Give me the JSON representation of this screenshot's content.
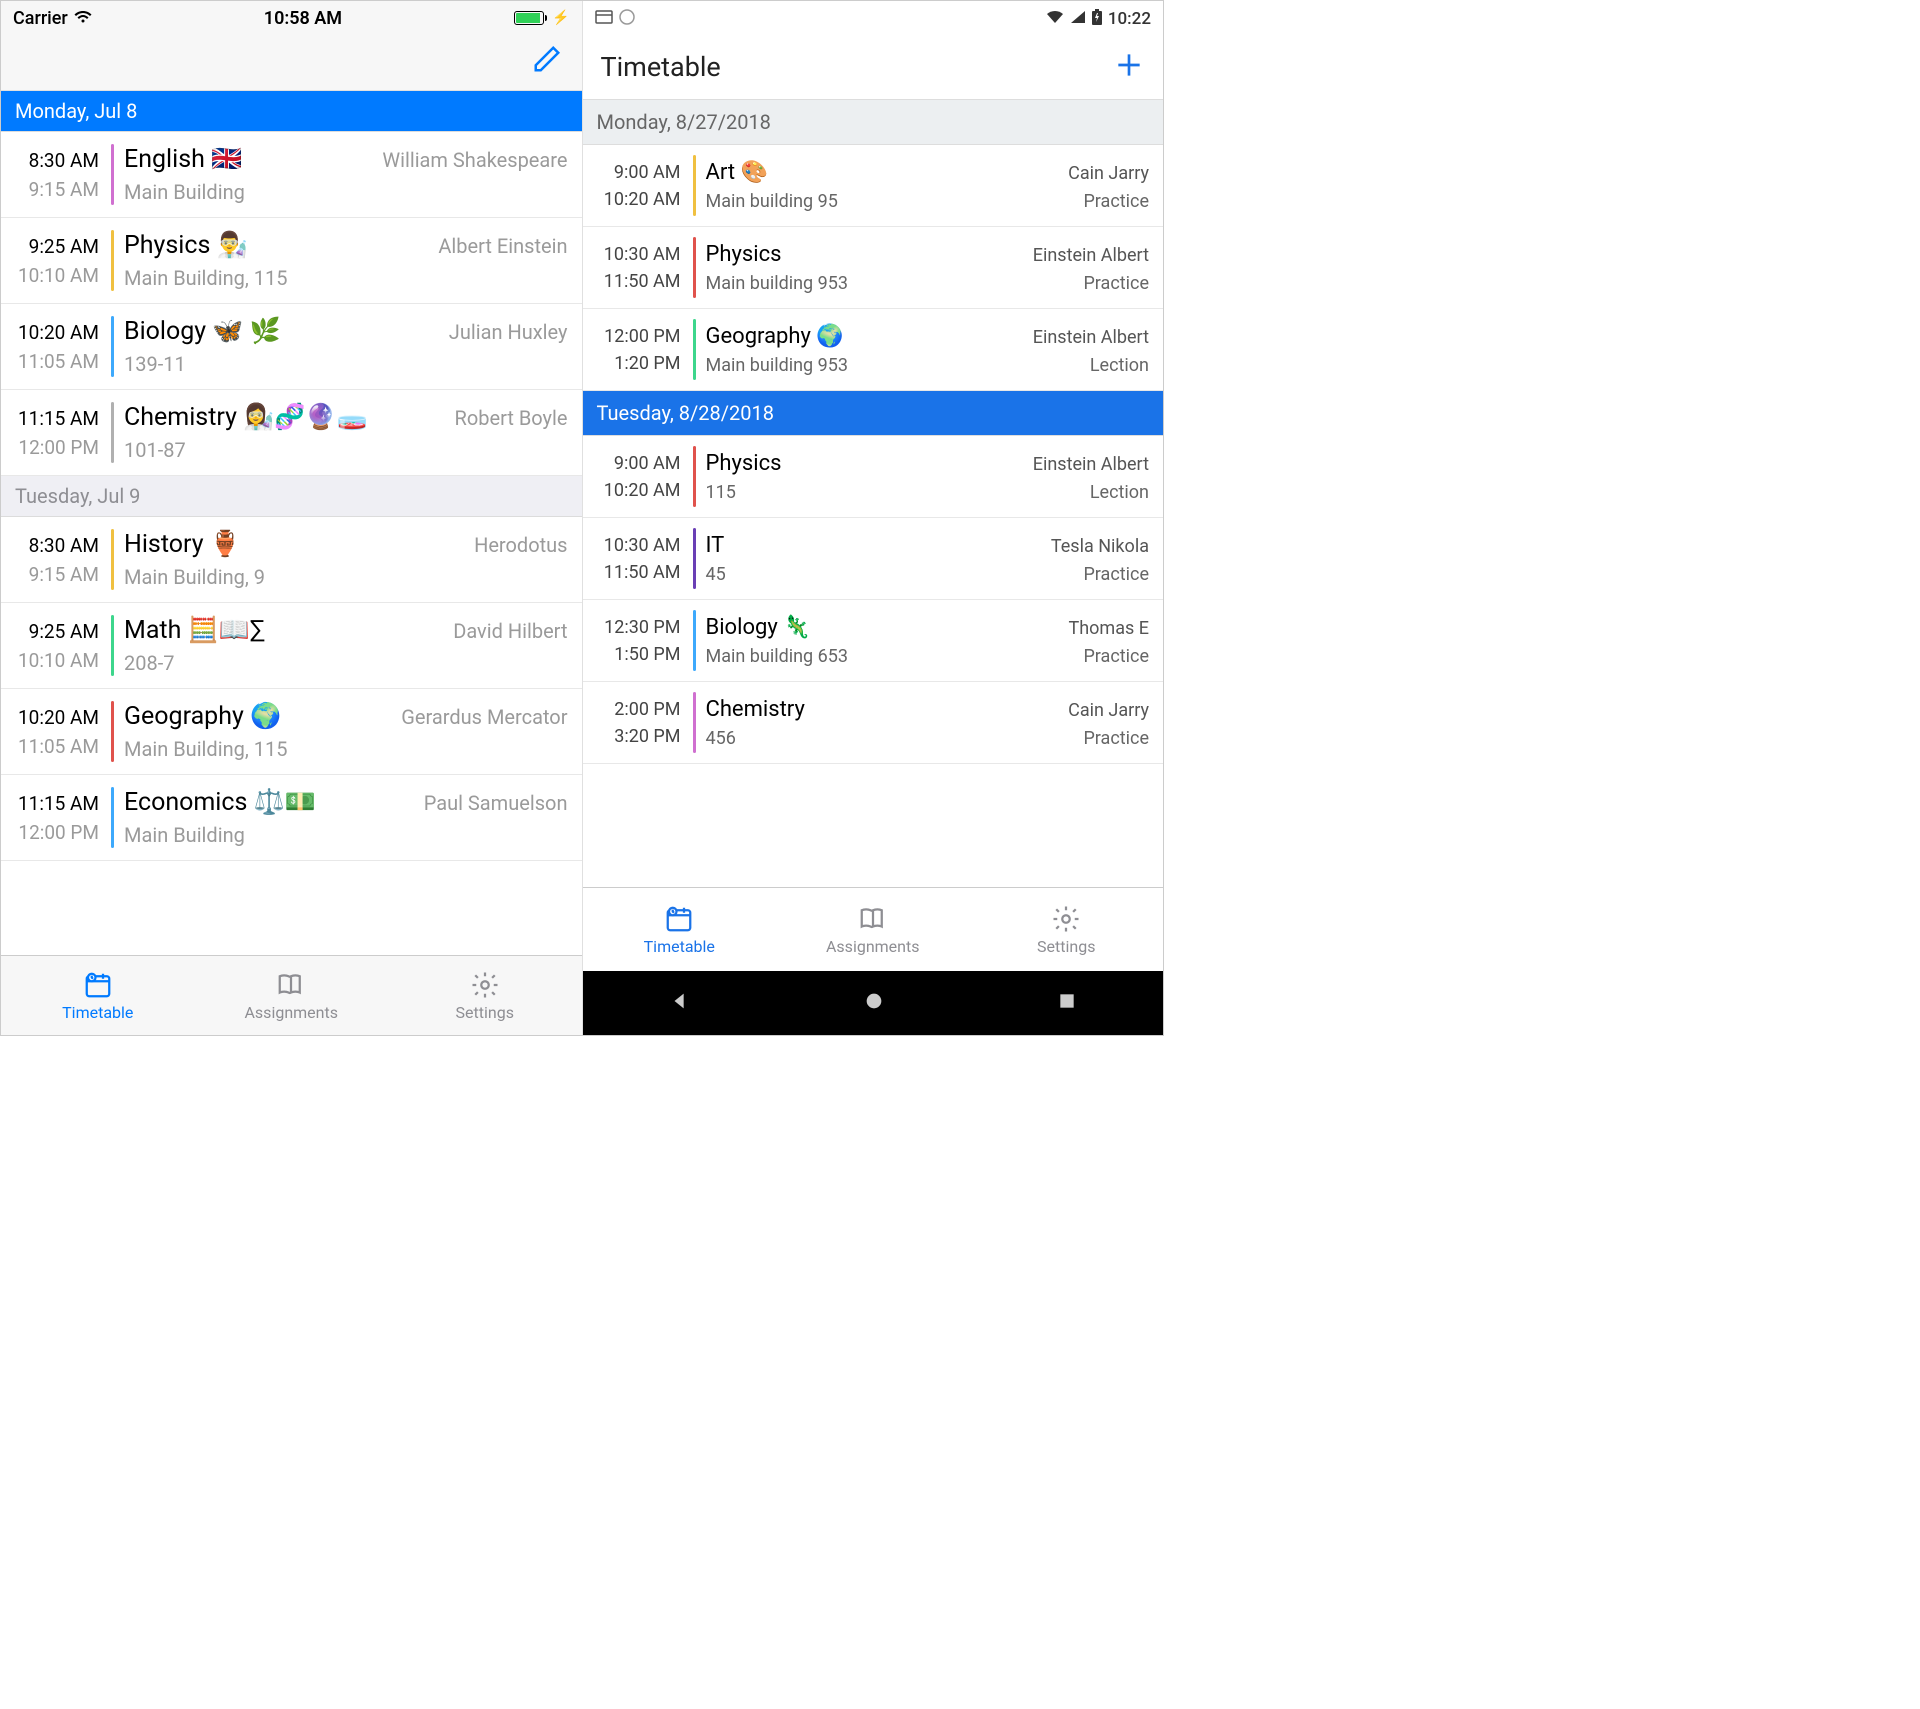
{
  "ios": {
    "status": {
      "carrier": "Carrier",
      "time": "10:58 AM"
    },
    "sections": [
      {
        "header": "Monday, Jul 8",
        "active": true,
        "rows": [
          {
            "start": "8:30 AM",
            "end": "9:15 AM",
            "subject": "English 🇬🇧",
            "teacher": "William Shakespeare",
            "location": "Main Building",
            "color": "#d070d0"
          },
          {
            "start": "9:25 AM",
            "end": "10:10 AM",
            "subject": "Physics 👨‍🔬",
            "teacher": "Albert Einstein",
            "location": "Main Building, 115",
            "color": "#f0c040"
          },
          {
            "start": "10:20 AM",
            "end": "11:05 AM",
            "subject": "Biology 🦋 🌿",
            "teacher": "Julian Huxley",
            "location": "139-11",
            "color": "#3da9fc"
          },
          {
            "start": "11:15 AM",
            "end": "12:00 PM",
            "subject": "Chemistry 👩‍🔬🧬🔮🧫",
            "teacher": "Robert Boyle",
            "location": "101-87",
            "color": "#b0b0b0"
          }
        ]
      },
      {
        "header": "Tuesday, Jul 9",
        "active": false,
        "rows": [
          {
            "start": "8:30 AM",
            "end": "9:15 AM",
            "subject": "History 🏺",
            "teacher": "Herodotus",
            "location": "Main Building, 9",
            "color": "#f0c040"
          },
          {
            "start": "9:25 AM",
            "end": "10:10 AM",
            "subject": "Math 🧮📖∑",
            "teacher": "David Hilbert",
            "location": "208-7",
            "color": "#3dd68c"
          },
          {
            "start": "10:20 AM",
            "end": "11:05 AM",
            "subject": "Geography 🌍",
            "teacher": "Gerardus Mercator",
            "location": "Main Building, 115",
            "color": "#e0524c"
          },
          {
            "start": "11:15 AM",
            "end": "12:00 PM",
            "subject": "Economics ⚖️💵",
            "teacher": "Paul Samuelson",
            "location": "Main Building",
            "color": "#3da9fc"
          }
        ]
      }
    ],
    "tabs": {
      "timetable": "Timetable",
      "assignments": "Assignments",
      "settings": "Settings"
    }
  },
  "android": {
    "status": {
      "time": "10:22"
    },
    "header": {
      "title": "Timetable"
    },
    "sections": [
      {
        "header": "Monday, 8/27/2018",
        "active": false,
        "rows": [
          {
            "start": "9:00 AM",
            "end": "10:20 AM",
            "subject": "Art 🎨",
            "teacher": "Cain Jarry",
            "location": "Main building 95",
            "session": "Practice",
            "color": "#f0c040"
          },
          {
            "start": "10:30 AM",
            "end": "11:50 AM",
            "subject": "Physics",
            "teacher": "Einstein Albert",
            "location": "Main building 953",
            "session": "Practice",
            "color": "#e0524c"
          },
          {
            "start": "12:00 PM",
            "end": "1:20 PM",
            "subject": "Geography 🌍",
            "teacher": "Einstein Albert",
            "location": "Main building 953",
            "session": "Lection",
            "color": "#3dd68c"
          }
        ]
      },
      {
        "header": "Tuesday, 8/28/2018",
        "active": true,
        "rows": [
          {
            "start": "9:00 AM",
            "end": "10:20 AM",
            "subject": "Physics",
            "teacher": "Einstein Albert",
            "location": "115",
            "session": "Lection",
            "color": "#e0524c"
          },
          {
            "start": "10:30 AM",
            "end": "11:50 AM",
            "subject": "IT",
            "teacher": "Tesla Nikola",
            "location": "45",
            "session": "Practice",
            "color": "#6a3fb5"
          },
          {
            "start": "12:30 PM",
            "end": "1:50 PM",
            "subject": "Biology 🦎",
            "teacher": "Thomas E",
            "location": "Main building 653",
            "session": "Practice",
            "color": "#3da9fc"
          },
          {
            "start": "2:00 PM",
            "end": "3:20 PM",
            "subject": "Chemistry",
            "teacher": "Cain Jarry",
            "location": "456",
            "session": "Practice",
            "color": "#d070d0"
          }
        ]
      }
    ],
    "tabs": {
      "timetable": "Timetable",
      "assignments": "Assignments",
      "settings": "Settings"
    }
  }
}
